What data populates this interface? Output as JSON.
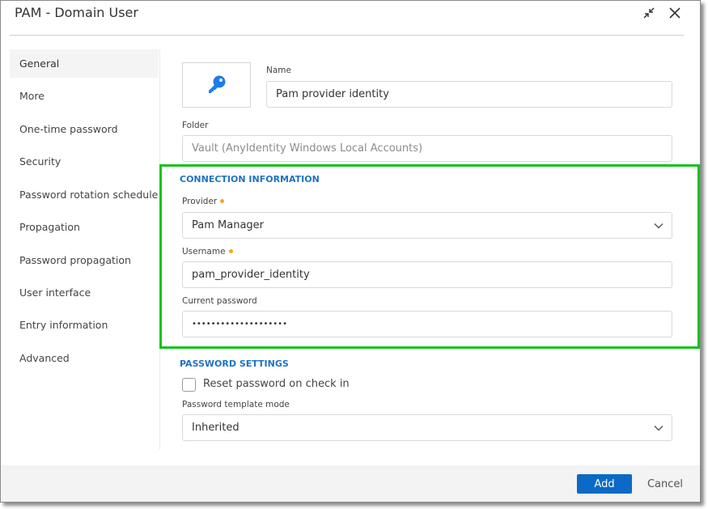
{
  "window": {
    "title": "PAM - Domain User",
    "minimize_icon": "collapse-arrows-icon",
    "close_icon": "close-x-icon"
  },
  "sidebar": {
    "items": [
      {
        "label": "General",
        "active": true
      },
      {
        "label": "More"
      },
      {
        "label": "One-time password"
      },
      {
        "label": "Security"
      },
      {
        "label": "Password rotation schedule"
      },
      {
        "label": "Propagation"
      },
      {
        "label": "Password propagation"
      },
      {
        "label": "User interface"
      },
      {
        "label": "Entry information"
      },
      {
        "label": "Advanced"
      }
    ]
  },
  "general": {
    "entry_icon": "key-icon",
    "name_label": "Name",
    "name_value": "Pam provider identity",
    "folder_label": "Folder",
    "folder_placeholder": "Vault (AnyIdentity Windows Local Accounts)"
  },
  "connection": {
    "section_title": "CONNECTION INFORMATION",
    "provider_label": "Provider",
    "provider_value": "Pam Manager",
    "username_label": "Username",
    "username_value": "pam_provider_identity",
    "password_label": "Current password",
    "password_value": "••••••••••••••••••••"
  },
  "password_settings": {
    "section_title": "PASSWORD SETTINGS",
    "reset_label": "Reset password on check in",
    "reset_checked": false,
    "template_label": "Password template mode",
    "template_value": "Inherited"
  },
  "footer": {
    "add_label": "Add",
    "cancel_label": "Cancel"
  },
  "colors": {
    "accent": "#0b6ac6",
    "section_title": "#1e72c5",
    "required_dot": "#f5a623",
    "highlight": "#12c31a"
  }
}
